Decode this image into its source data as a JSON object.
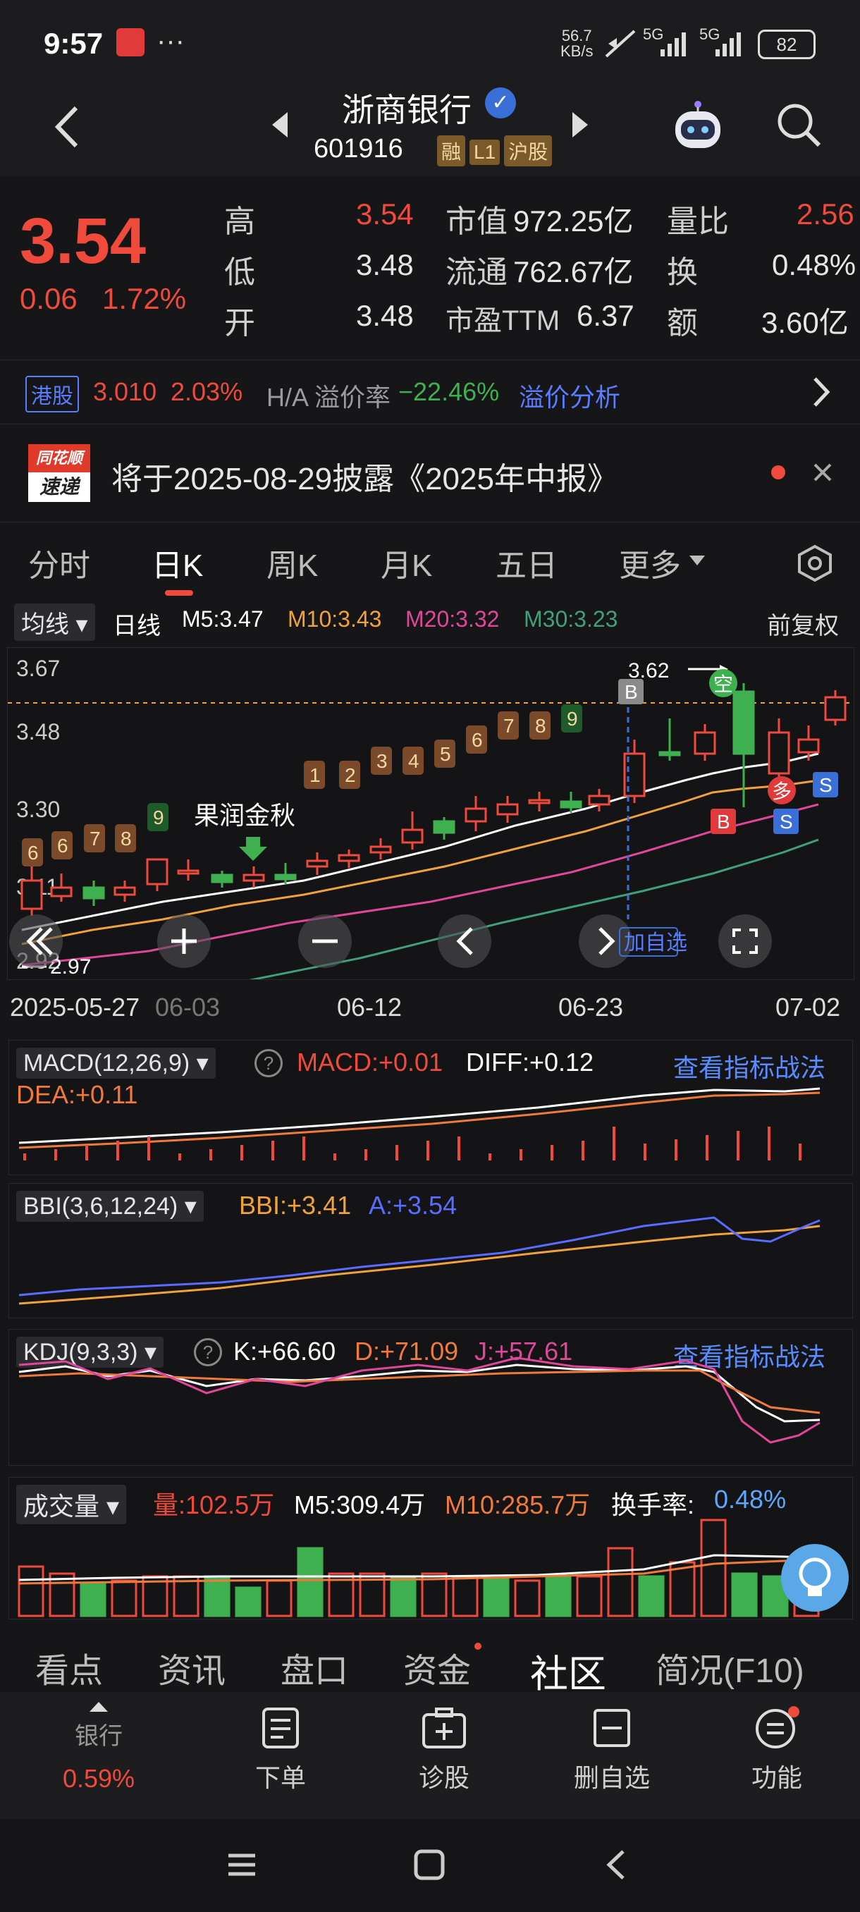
{
  "status": {
    "time": "9:57",
    "net_speed_top": "56.7",
    "net_speed_bottom": "KB/s",
    "battery": "82",
    "signal1": "5G",
    "signal2": "5G",
    "more": "···"
  },
  "header": {
    "stock_name": "浙商银行",
    "code": "601916",
    "tags": [
      "融",
      "L1",
      "沪股"
    ]
  },
  "quote": {
    "price": "3.54",
    "change": "0.06",
    "change_pct": "1.72%",
    "high_label": "高",
    "high": "3.54",
    "low_label": "低",
    "low": "3.48",
    "open_label": "开",
    "open": "3.48",
    "mcap_label": "市值",
    "mcap": "972.25亿",
    "float_label": "流通",
    "float": "762.67亿",
    "pe_label": "市盈TTM",
    "pe": "6.37",
    "vol_ratio_label": "量比",
    "vol_ratio": "2.56",
    "turnover_label": "换",
    "turnover": "0.48%",
    "amount_label": "额",
    "amount": "3.60亿"
  },
  "hk": {
    "badge": "港股",
    "price": "3.010",
    "pct": "2.03%",
    "premium_label": "H/A 溢价率",
    "premium": "−22.46%",
    "link": "溢价分析"
  },
  "news": {
    "logo_top": "同花顺",
    "logo_bottom": "速递",
    "text": "将于2025-08-29披露《2025年中报》"
  },
  "tabs": [
    "分时",
    "日K",
    "周K",
    "月K",
    "五日",
    "更多"
  ],
  "ma": {
    "selector": "均线",
    "period": "日线",
    "m5": "M5:3.47",
    "m10": "M10:3.43",
    "m20": "M20:3.32",
    "m30": "M30:3.23",
    "adjust": "前复权"
  },
  "chart": {
    "y_labels": [
      "3.67",
      "3.48",
      "3.30",
      "3.11",
      "2.92"
    ],
    "high_marker": "3.62",
    "low_marker": "2.97",
    "event": "果润金秋",
    "add_watch": "加自选",
    "buy_label": "B",
    "sell_label": "S",
    "long_label": "多",
    "short_label": "空",
    "dates": [
      "2025-05-27",
      "06-03",
      "06-12",
      "06-23",
      "07-02"
    ],
    "colors": {
      "up": "#f04a3c",
      "down": "#3fb04f",
      "m5": "#ffffff",
      "m10": "#f0a23c",
      "m20": "#e0469a",
      "m30": "#3fa07a"
    },
    "seq_numbers": [
      "6",
      "6",
      "7",
      "8",
      "9",
      "1",
      "2",
      "3",
      "4",
      "5",
      "6",
      "7",
      "8",
      "9"
    ]
  },
  "macd": {
    "name": "MACD(12,26,9)",
    "macd": "MACD:+0.01",
    "diff": "DIFF:+0.12",
    "dea": "DEA:+0.11",
    "link": "查看指标战法"
  },
  "bbi": {
    "name": "BBI(3,6,12,24)",
    "bbi": "BBI:+3.41",
    "a": "A:+3.54"
  },
  "kdj": {
    "name": "KDJ(9,3,3)",
    "k": "K:+66.60",
    "d": "D:+71.09",
    "j": "J:+57.61",
    "link": "查看指标战法"
  },
  "volume": {
    "name": "成交量",
    "vol": "量:102.5万",
    "m5": "M5:309.4万",
    "m10": "M10:285.7万",
    "turnover_label": "换手率:",
    "turnover": "0.48%"
  },
  "bottom_tabs": [
    "看点",
    "资讯",
    "盘口",
    "资金",
    "社区",
    "简况(F10)"
  ],
  "dock": {
    "sector": "银行",
    "sector_pct": "0.59%",
    "items": [
      "下单",
      "诊股",
      "删自选",
      "功能"
    ]
  }
}
